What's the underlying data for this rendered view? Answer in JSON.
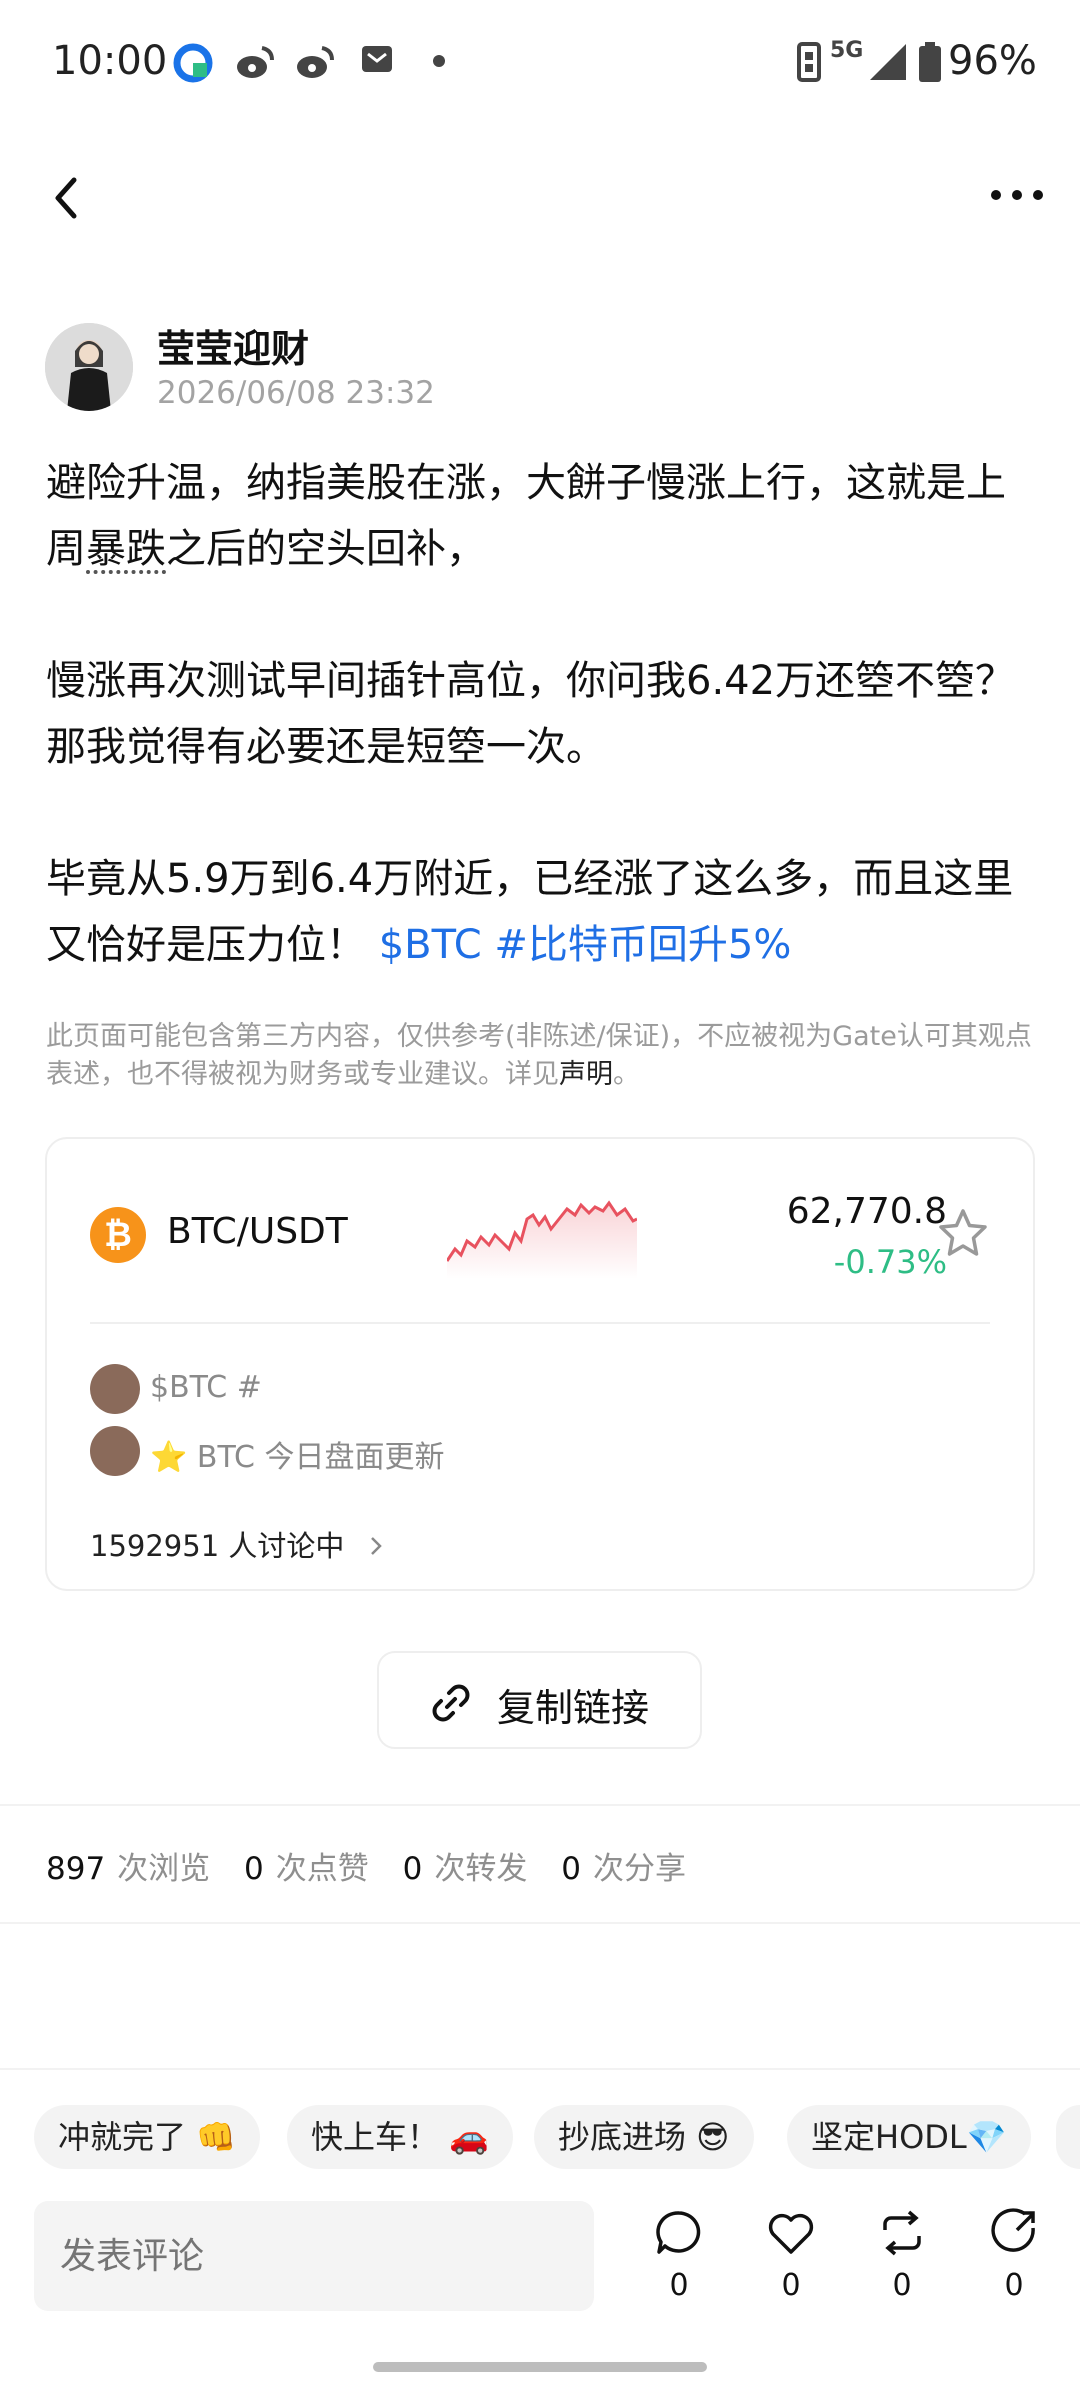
{
  "status_bar": {
    "time": "10:00",
    "network": "5G",
    "battery": "96%"
  },
  "author": {
    "name": "莹莹迎财",
    "timestamp": "2026/06/08 23:32"
  },
  "post": {
    "p1_a": "避险升温，纳指美股在涨，大餅子慢涨上行，这就是上周",
    "p1_b": "暴跌",
    "p1_c": "之后的空头回补，",
    "p2": "慢涨再次测试早间插针高位，你问我6.42万还箜不箜？那我觉得有必要还是短箜一次。",
    "p3": "毕竟从5.9万到6.4万附近，已经涨了这么多，而且这里又恰好是压力位！",
    "tag_coin": "$BTC",
    "tag_topic": "#比特币回升5%"
  },
  "disclaimer": {
    "text": "此页面可能包含第三方内容，仅供参考(非陈述/保证)，不应被视为Gate认可其观点表述，也不得被视为财务或专业建议。详见",
    "link": "声明",
    "end": "。"
  },
  "market": {
    "pair": "BTC/USDT",
    "coin_symbol": "₿",
    "price": "62,770.8",
    "change": "-0.73%",
    "feed": [
      "$BTC #",
      "⭐ BTC 今日盘面更新"
    ],
    "discussion": "1592951 人讨论中"
  },
  "copy_link": "复制链接",
  "stats": [
    {
      "num": "897",
      "label": "次浏览"
    },
    {
      "num": "0",
      "label": "次点赞"
    },
    {
      "num": "0",
      "label": "次转发"
    },
    {
      "num": "0",
      "label": "次分享"
    }
  ],
  "quick_replies": [
    "冲就完了 👊",
    "快上车！ 🚗",
    "抄底进场 😎",
    "坚定HODL💎"
  ],
  "comment_placeholder": "发表评论",
  "actions": {
    "comment": "0",
    "like": "0",
    "repost": "0",
    "share": "0"
  },
  "colors": {
    "accent": "#1f6fe5",
    "down": "#2ebd85",
    "chart": "#e8525f",
    "btc": "#f7931a"
  }
}
